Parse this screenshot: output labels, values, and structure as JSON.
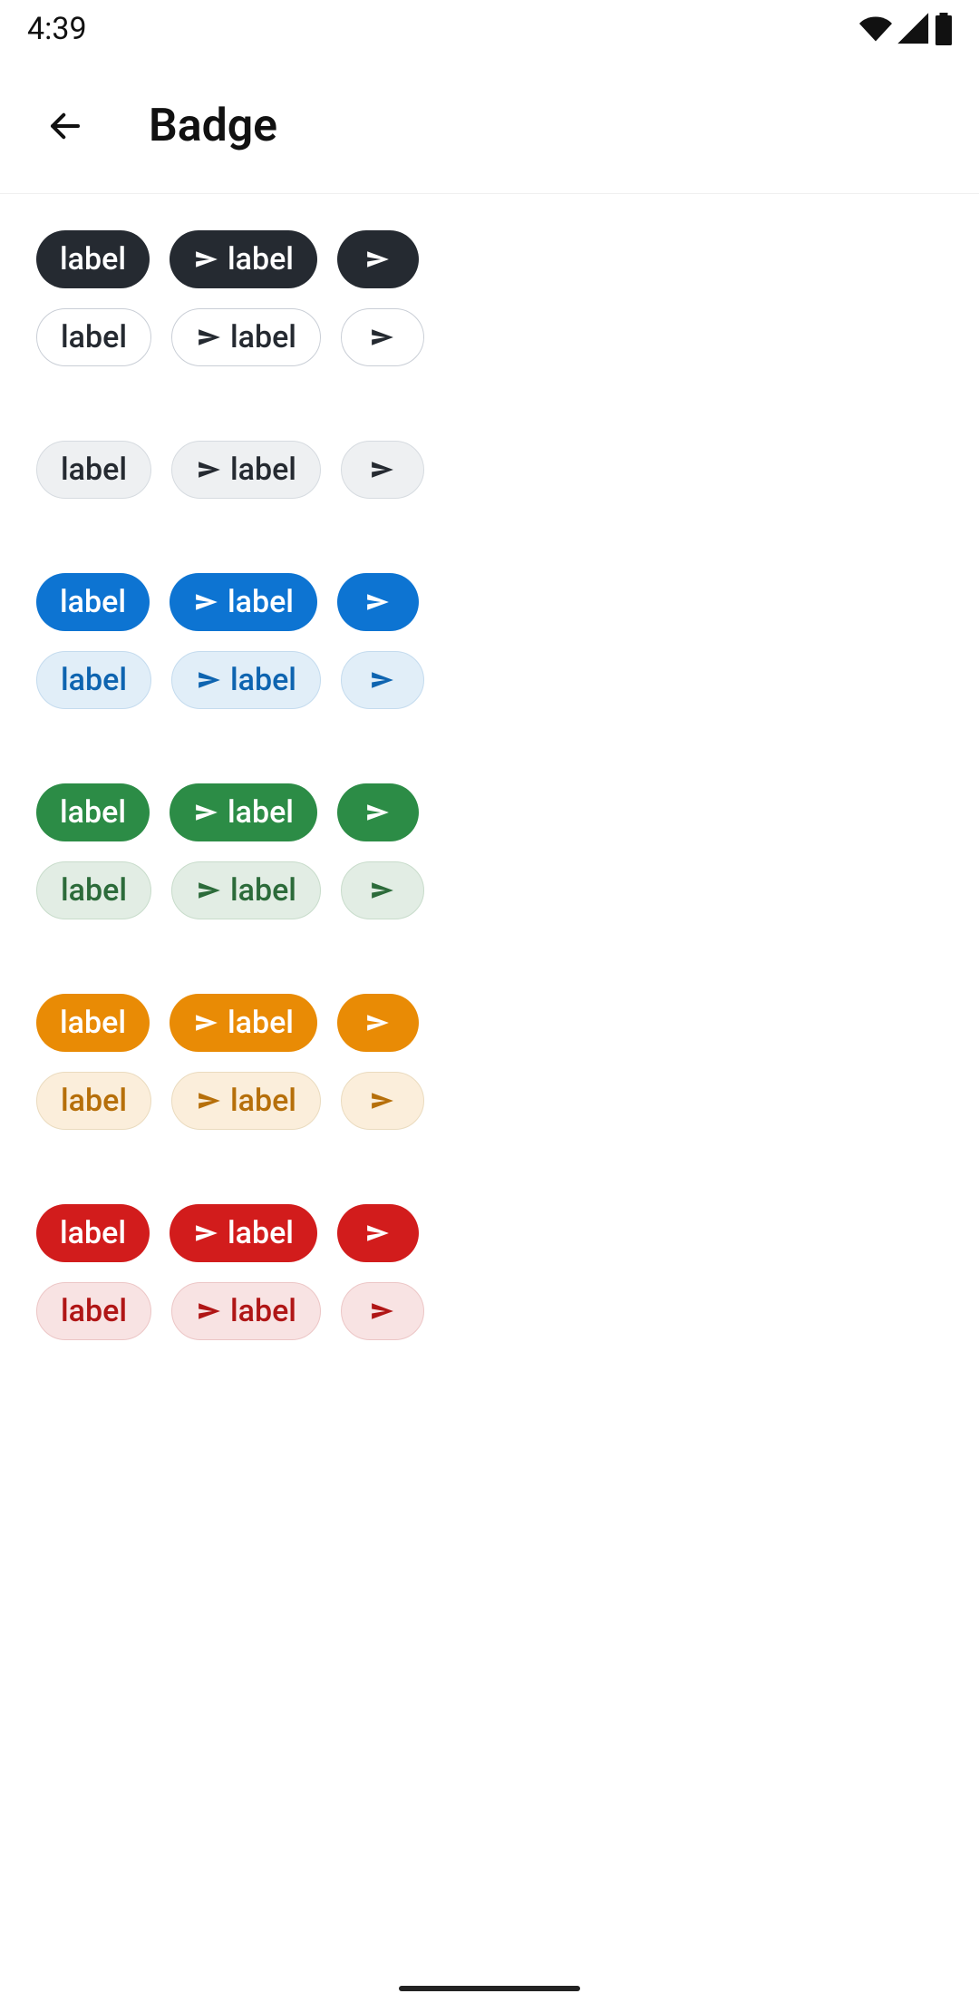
{
  "status_bar": {
    "time": "4:39"
  },
  "app_bar": {
    "title": "Badge"
  },
  "badge_label": "label",
  "groups": [
    {
      "rows": [
        {
          "variant": "dark-solid"
        },
        {
          "variant": "dark-outline"
        }
      ]
    },
    {
      "rows": [
        {
          "variant": "dark-subtle"
        }
      ]
    },
    {
      "rows": [
        {
          "variant": "blue-solid"
        },
        {
          "variant": "blue-subtle"
        }
      ]
    },
    {
      "rows": [
        {
          "variant": "green-solid"
        },
        {
          "variant": "green-subtle"
        }
      ]
    },
    {
      "rows": [
        {
          "variant": "orange-solid"
        },
        {
          "variant": "orange-subtle"
        }
      ]
    },
    {
      "rows": [
        {
          "variant": "red-solid"
        },
        {
          "variant": "red-subtle"
        }
      ]
    }
  ]
}
